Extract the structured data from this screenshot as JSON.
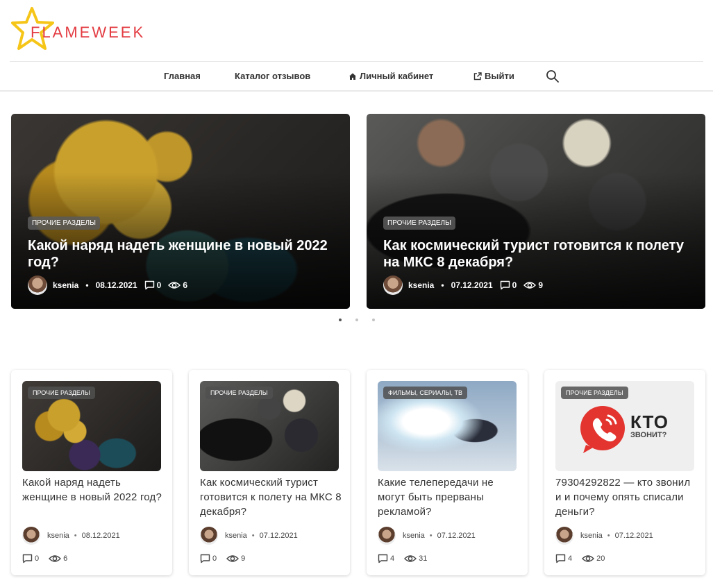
{
  "brand": {
    "name": "FLAMEWEEK",
    "accent": "#e33d43",
    "star_color": "#f5c518"
  },
  "nav": {
    "items": [
      {
        "label": "Главная"
      },
      {
        "label": "Каталог отзывов"
      },
      {
        "label": "Личный кабинет",
        "icon": "home-icon"
      },
      {
        "label": "Выйти",
        "icon": "external-link-icon"
      }
    ],
    "search_icon": "search-icon"
  },
  "slider": {
    "slides": [
      {
        "category": "ПРОЧИЕ РАЗДЕЛЫ",
        "title": "Какой наряд надеть женщине в новый 2022 год?",
        "author": "ksenia",
        "date": "08.12.2021",
        "comments": "0",
        "views": "6"
      },
      {
        "category": "ПРОЧИЕ РАЗДЕЛЫ",
        "title": "Как космический турист готовится к полету на МКС 8 декабря?",
        "author": "ksenia",
        "date": "07.12.2021",
        "comments": "0",
        "views": "9"
      }
    ],
    "pages": 3,
    "active_page": 1
  },
  "cards": [
    {
      "category": "ПРОЧИЕ РАЗДЕЛЫ",
      "title": "Какой наряд надеть женщине в новый 2022 год?",
      "author": "ksenia",
      "date": "08.12.2021",
      "comments": "0",
      "views": "6"
    },
    {
      "category": "ПРОЧИЕ РАЗДЕЛЫ",
      "title": "Как космический турист готовится к полету на МКС 8 декабря?",
      "author": "ksenia",
      "date": "07.12.2021",
      "comments": "0",
      "views": "9"
    },
    {
      "category": "ФИЛЬМЫ, СЕРИАЛЫ, ТВ",
      "title": "Какие телепередачи не могут быть прерваны рекламой?",
      "author": "ksenia",
      "date": "07.12.2021",
      "comments": "4",
      "views": "31"
    },
    {
      "category": "ПРОЧИЕ РАЗДЕЛЫ",
      "title": "79304292822 — кто звонил и и почему опять списали деньги?",
      "author": "ksenia",
      "date": "07.12.2021",
      "comments": "4",
      "views": "20",
      "image_text_main": "КТО",
      "image_text_sub": "ЗВОНИТ?"
    }
  ]
}
